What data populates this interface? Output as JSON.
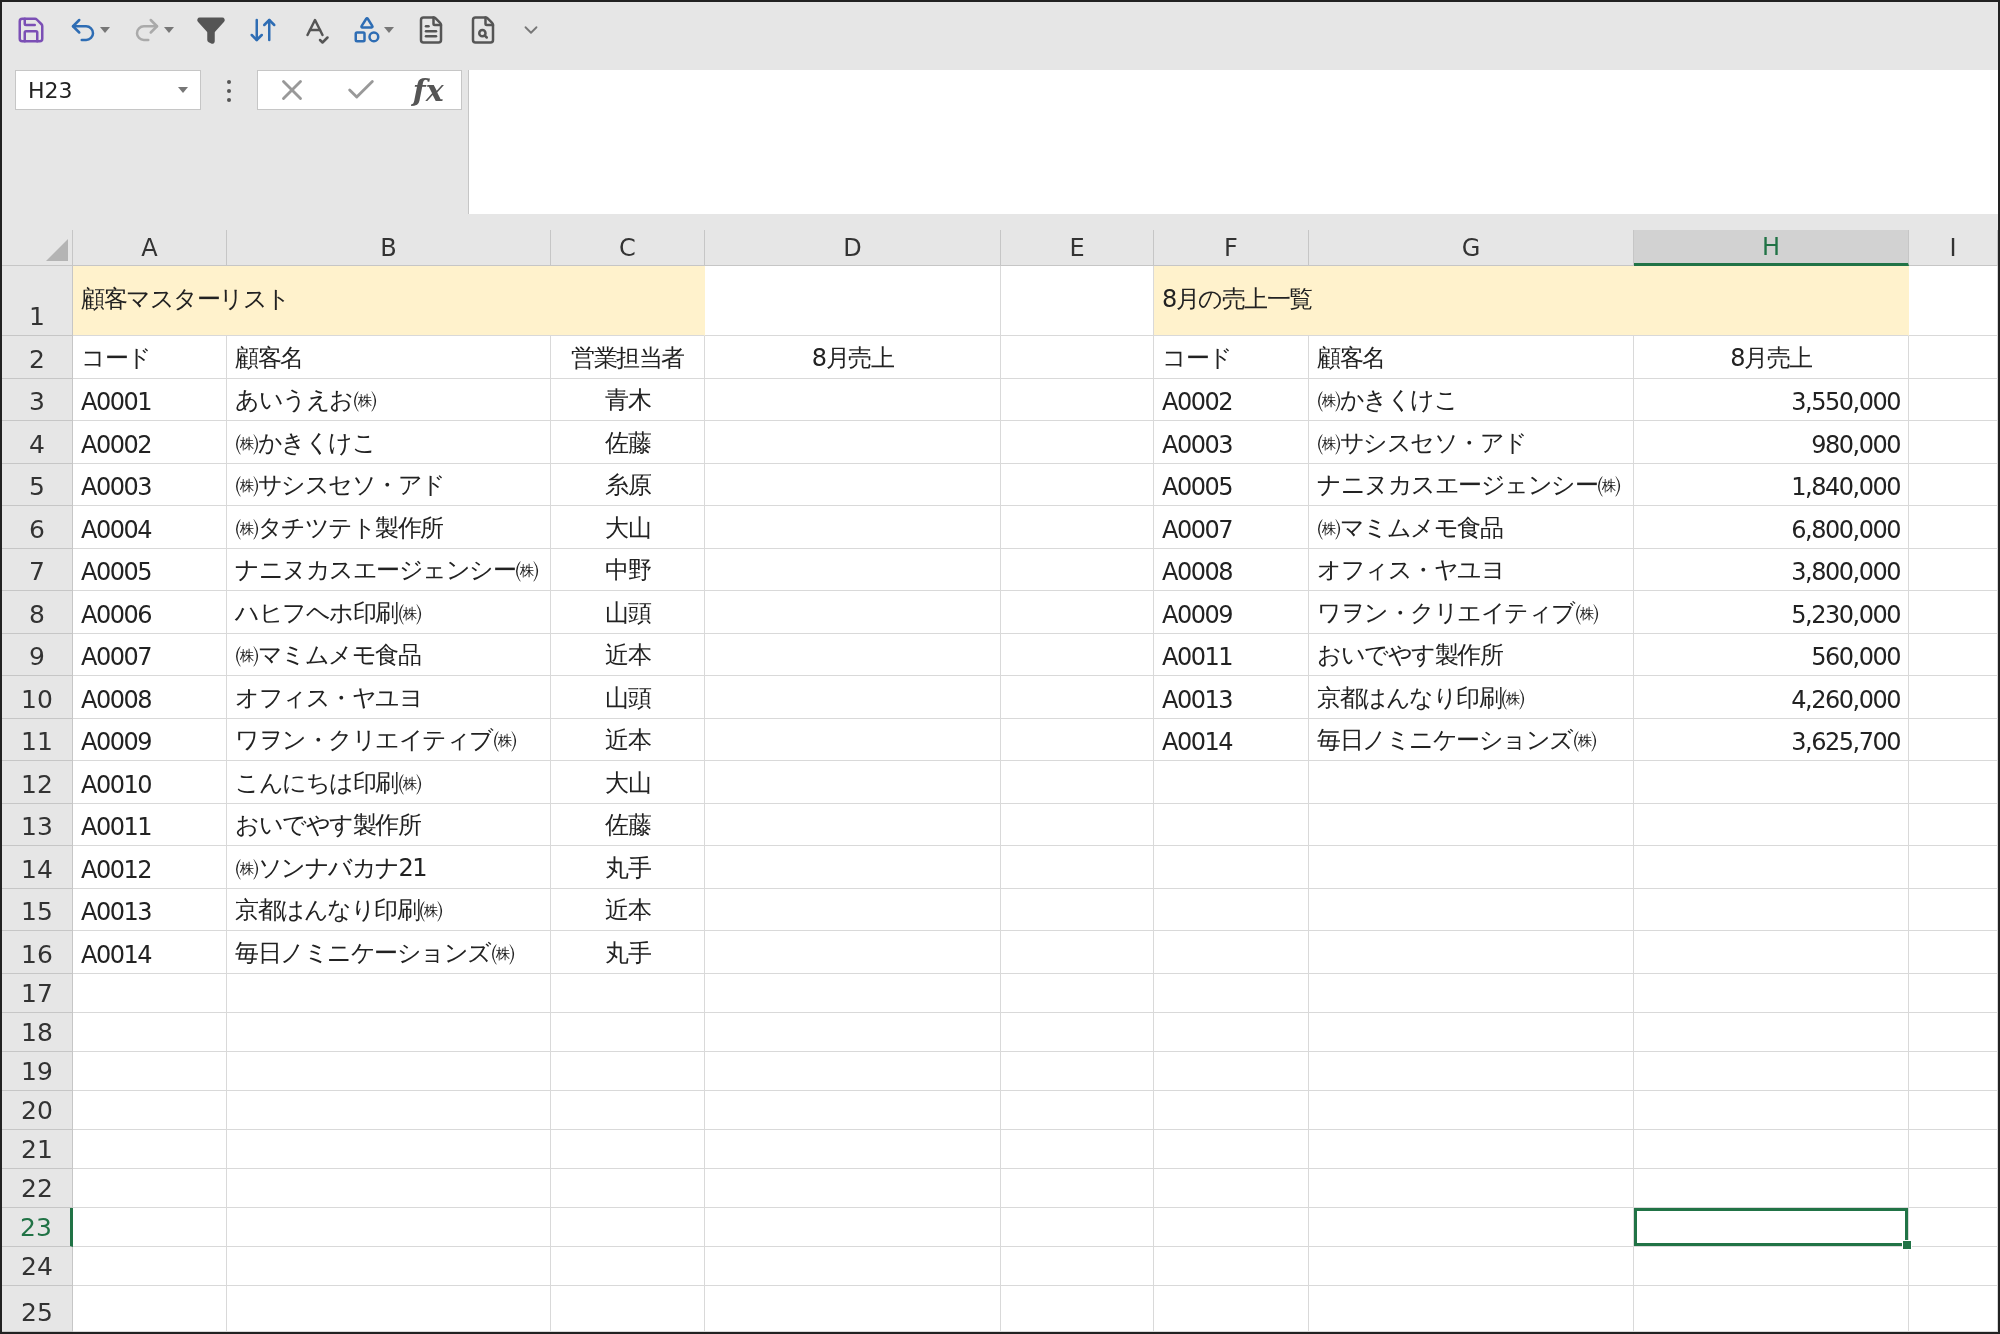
{
  "name_box": {
    "value": "H23"
  },
  "formula_bar": {
    "function_label": "fx"
  },
  "column_headers": [
    {
      "label": "A",
      "selected": false
    },
    {
      "label": "B",
      "selected": false
    },
    {
      "label": "C",
      "selected": false
    },
    {
      "label": "D",
      "selected": false
    },
    {
      "label": "E",
      "selected": false
    },
    {
      "label": "F",
      "selected": false
    },
    {
      "label": "G",
      "selected": false
    },
    {
      "label": "H",
      "selected": true
    },
    {
      "label": "I",
      "selected": false
    }
  ],
  "row_headers": [
    {
      "label": "1",
      "selected": false
    },
    {
      "label": "2",
      "selected": false
    },
    {
      "label": "3",
      "selected": false
    },
    {
      "label": "4",
      "selected": false
    },
    {
      "label": "5",
      "selected": false
    },
    {
      "label": "6",
      "selected": false
    },
    {
      "label": "7",
      "selected": false
    },
    {
      "label": "8",
      "selected": false
    },
    {
      "label": "9",
      "selected": false
    },
    {
      "label": "10",
      "selected": false
    },
    {
      "label": "11",
      "selected": false
    },
    {
      "label": "12",
      "selected": false
    },
    {
      "label": "13",
      "selected": false
    },
    {
      "label": "14",
      "selected": false
    },
    {
      "label": "15",
      "selected": false
    },
    {
      "label": "16",
      "selected": false
    },
    {
      "label": "17",
      "selected": false
    },
    {
      "label": "18",
      "selected": false
    },
    {
      "label": "19",
      "selected": false
    },
    {
      "label": "20",
      "selected": false
    },
    {
      "label": "21",
      "selected": false
    },
    {
      "label": "22",
      "selected": false
    },
    {
      "label": "23",
      "selected": true
    },
    {
      "label": "24",
      "selected": false
    },
    {
      "label": "25",
      "selected": false
    }
  ],
  "customer_master": {
    "title": "顧客マスターリスト",
    "headers": [
      "コード",
      "顧客名",
      "営業担当者",
      "8月売上"
    ],
    "rows": [
      {
        "code": "A0001",
        "name": "あいうえお㈱",
        "rep": "青木"
      },
      {
        "code": "A0002",
        "name": "㈱かきくけこ",
        "rep": "佐藤"
      },
      {
        "code": "A0003",
        "name": "㈱サシスセソ・アド",
        "rep": "糸原"
      },
      {
        "code": "A0004",
        "name": "㈱タチツテト製作所",
        "rep": "大山"
      },
      {
        "code": "A0005",
        "name": "ナニヌカスエージェンシー㈱",
        "rep": "中野"
      },
      {
        "code": "A0006",
        "name": "ハヒフヘホ印刷㈱",
        "rep": "山頭"
      },
      {
        "code": "A0007",
        "name": "㈱マミムメモ食品",
        "rep": "近本"
      },
      {
        "code": "A0008",
        "name": "オフィス・ヤユヨ",
        "rep": "山頭"
      },
      {
        "code": "A0009",
        "name": "ワヲン・クリエイティブ㈱",
        "rep": "近本"
      },
      {
        "code": "A0010",
        "name": "こんにちは印刷㈱",
        "rep": "大山"
      },
      {
        "code": "A0011",
        "name": "おいでやす製作所",
        "rep": "佐藤"
      },
      {
        "code": "A0012",
        "name": "㈱ソンナバカナ21",
        "rep": "丸手"
      },
      {
        "code": "A0013",
        "name": "京都はんなり印刷㈱",
        "rep": "近本"
      },
      {
        "code": "A0014",
        "name": "毎日ノミニケーションズ㈱",
        "rep": "丸手"
      }
    ]
  },
  "august_sales": {
    "title": "8月の売上一覧",
    "headers": [
      "コード",
      "顧客名",
      "8月売上"
    ],
    "rows": [
      {
        "code": "A0002",
        "name": "㈱かきくけこ",
        "sales": "3,550,000"
      },
      {
        "code": "A0003",
        "name": "㈱サシスセソ・アド",
        "sales": "980,000"
      },
      {
        "code": "A0005",
        "name": "ナニヌカスエージェンシー㈱",
        "sales": "1,840,000"
      },
      {
        "code": "A0007",
        "name": "㈱マミムメモ食品",
        "sales": "6,800,000"
      },
      {
        "code": "A0008",
        "name": "オフィス・ヤユヨ",
        "sales": "3,800,000"
      },
      {
        "code": "A0009",
        "name": "ワヲン・クリエイティブ㈱",
        "sales": "5,230,000"
      },
      {
        "code": "A0011",
        "name": "おいでやす製作所",
        "sales": "560,000"
      },
      {
        "code": "A0013",
        "name": "京都はんなり印刷㈱",
        "sales": "4,260,000"
      },
      {
        "code": "A0014",
        "name": "毎日ノミニケーションズ㈱",
        "sales": "3,625,700"
      }
    ]
  }
}
